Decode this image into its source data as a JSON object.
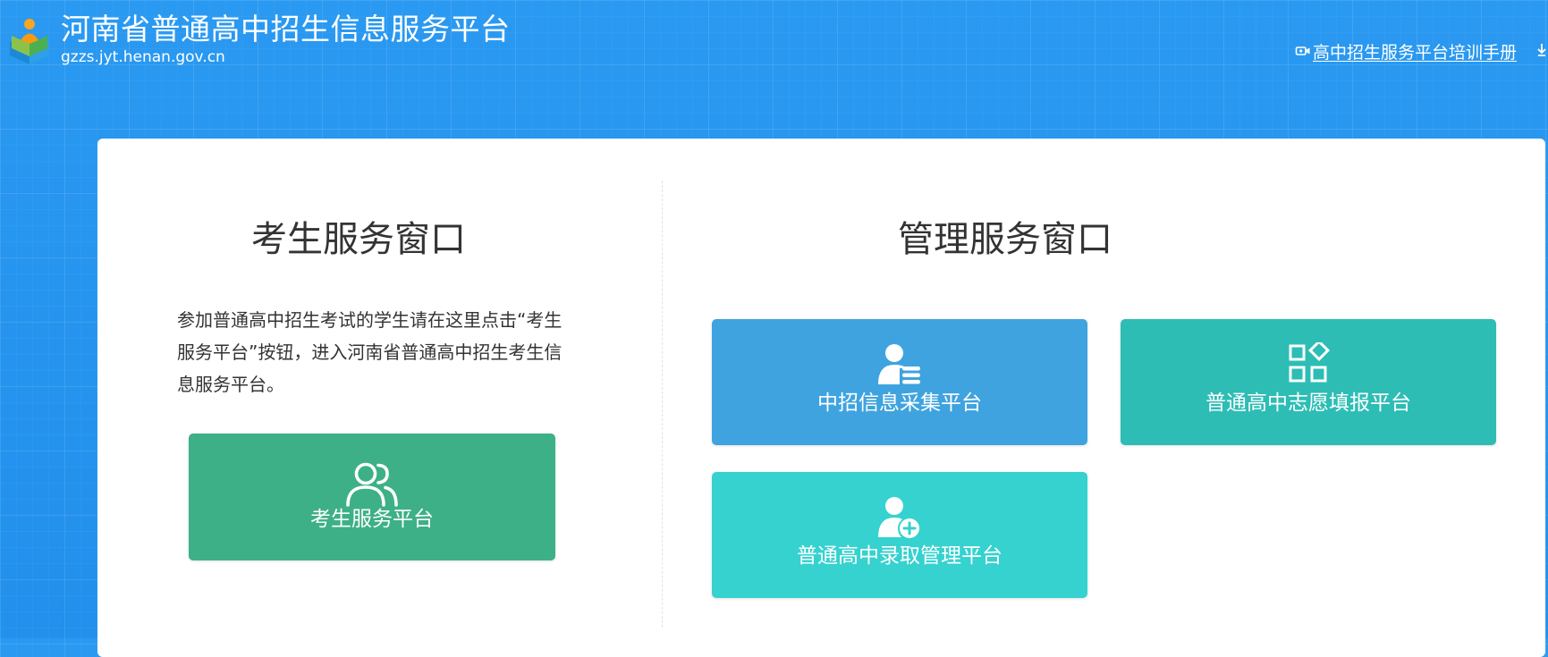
{
  "header": {
    "logo_icon": "book-reader-logo-icon",
    "title": "河南省普通高中招生信息服务平台",
    "domain": "gzzs.jyt.henan.gov.cn",
    "manual_link": {
      "icon": "video-camera-icon",
      "label": "高中招生服务平台培训手册"
    }
  },
  "student_section": {
    "title": "考生服务窗口",
    "description": "参加普通高中招生考试的学生请在这里点击“考生服务平台”按钮，进入河南省普通高中招生考生信息服务平台。",
    "button": {
      "label": "考生服务平台",
      "icon": "users-icon",
      "color": "#3db087"
    }
  },
  "admin_section": {
    "title": "管理服务窗口",
    "buttons": [
      {
        "label": "中招信息采集平台",
        "icon": "user-list-icon",
        "color": "#3fa3df"
      },
      {
        "label": "普通高中志愿填报平台",
        "icon": "app-grid-icon",
        "color": "#2dbdb5"
      },
      {
        "label": "普通高中录取管理平台",
        "icon": "user-add-icon",
        "color": "#35d2cf"
      }
    ]
  },
  "colors": {
    "background": "#2596f0",
    "card": "#ffffff",
    "text": "#333333"
  }
}
